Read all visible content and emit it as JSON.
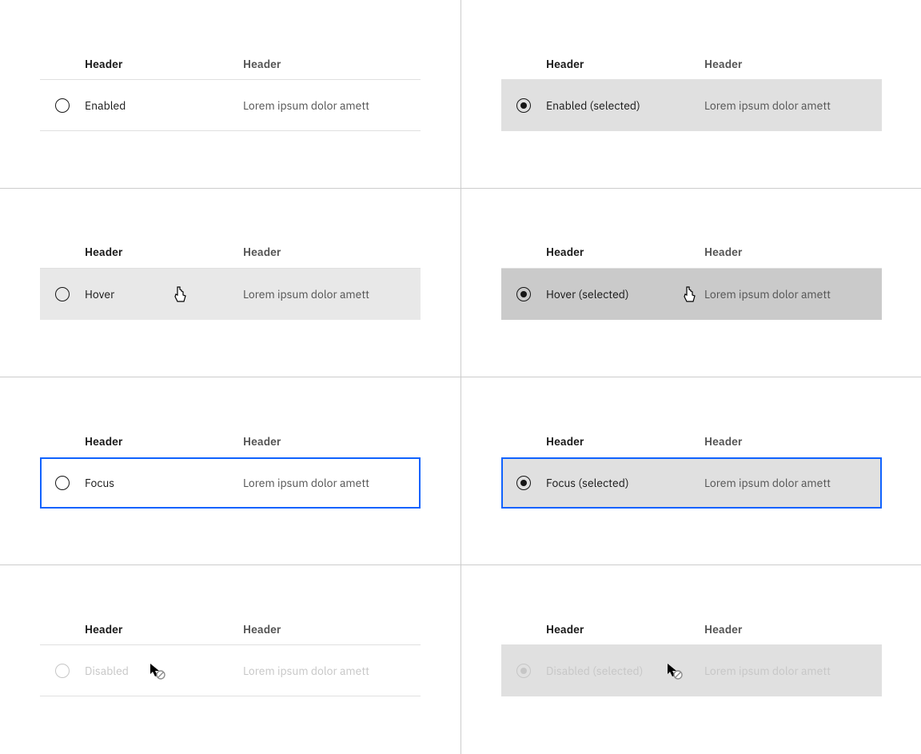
{
  "headers": {
    "col1": "Header",
    "col2": "Header"
  },
  "body": "Lorem ipsum dolor amett",
  "states": {
    "enabled": {
      "label": "Enabled",
      "selectedLabel": "Enabled (selected)"
    },
    "hover": {
      "label": "Hover",
      "selectedLabel": "Hover (selected)"
    },
    "focus": {
      "label": "Focus",
      "selectedLabel": "Focus (selected)"
    },
    "disabled": {
      "label": "Disabled",
      "selectedLabel": "Disabled (selected)"
    }
  },
  "colors": {
    "focusRing": "#0f62fe",
    "selectedRow": "#e0e0e0",
    "hoverRow": "#e8e8e8",
    "selectedHoverRow": "#cacaca",
    "textPrimary": "#161616",
    "textSecondary": "#525252",
    "disabled": "#c6c6c6"
  }
}
